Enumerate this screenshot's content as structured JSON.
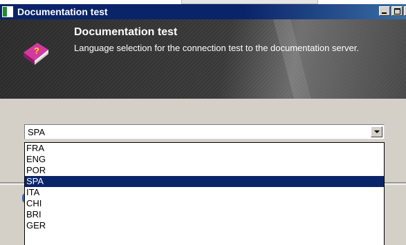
{
  "window": {
    "title": "Documentation test"
  },
  "header": {
    "title": "Documentation test",
    "description": "Language selection for the connection test to the documentation server."
  },
  "language_select": {
    "value": "SPA",
    "options": [
      "FRA",
      "ENG",
      "POR",
      "SPA",
      "ITA",
      "CHI",
      "BRI",
      "GER"
    ],
    "highlighted": "SPA"
  },
  "colors": {
    "titlebar": "#0a246a",
    "selection": "#0a246a",
    "header_bg": "#333333"
  }
}
